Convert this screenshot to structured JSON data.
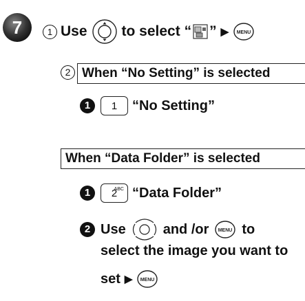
{
  "step": {
    "number": "7",
    "substep1_marker": "1",
    "line1_use": "Use",
    "line1_select": "to select “",
    "line1_close": "”",
    "arrow": "▶",
    "menu_key": "MENU"
  },
  "substep2": {
    "marker": "2",
    "section_no_setting": "When “No Setting” is selected",
    "no_setting_bullet": "1",
    "no_setting_key": "1",
    "no_setting_label": "“No Setting”",
    "section_data_folder": "When “Data Folder” is selected",
    "data_folder_bullet": "1",
    "data_folder_key": "2",
    "data_folder_key_sub": "ABC",
    "data_folder_label": "“Data Folder”",
    "bullet2": "2",
    "b2_use": "Use",
    "b2_andor": "and /or",
    "b2_to": "to",
    "b2_line2": "select the image you want to",
    "b2_line3": "set",
    "arrow": "▶",
    "menu_key": "MENU"
  },
  "colors": {
    "badge": "#222222",
    "text": "#111111"
  }
}
